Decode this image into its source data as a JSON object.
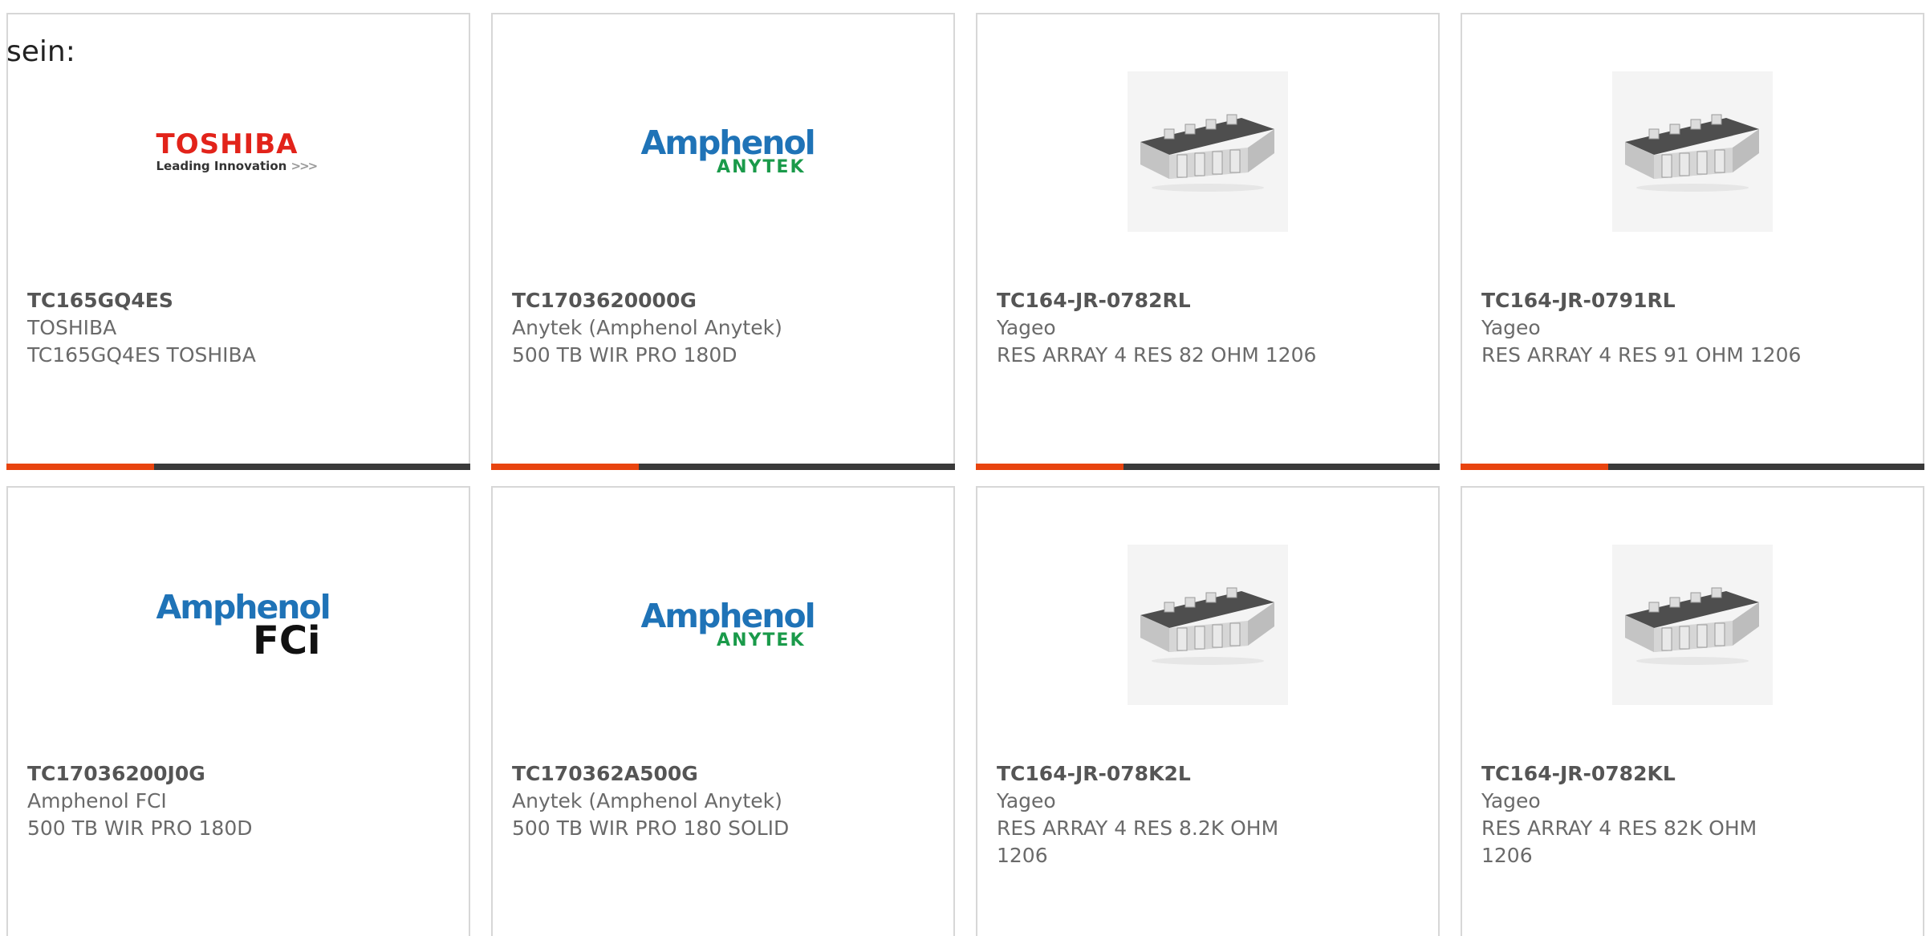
{
  "intro_text": "sein:",
  "brand_colors": {
    "accent_bar": "#e8440f",
    "bar": "#3a3a3a",
    "toshiba_red": "#e2231a",
    "amphenol_blue": "#1f73b7",
    "anytek_green": "#1a9a4a"
  },
  "logos": {
    "toshiba": {
      "name": "TOSHIBA",
      "tagline": "Leading Innovation",
      "chevrons": ">>>"
    },
    "amphenol_anytek": {
      "name": "Amphenol",
      "sub": "ANYTEK"
    },
    "amphenol_fci": {
      "name": "Amphenol",
      "sub": "FCi"
    }
  },
  "products": [
    {
      "part": "TC165GQ4ES",
      "manufacturer": "TOSHIBA",
      "description": "TC165GQ4ES TOSHIBA",
      "image": "toshiba-logo"
    },
    {
      "part": "TC1703620000G",
      "manufacturer": "Anytek (Amphenol Anytek)",
      "description": "500 TB WIR PRO 180D",
      "image": "amphenol-anytek-logo"
    },
    {
      "part": "TC164-JR-0782RL",
      "manufacturer": "Yageo",
      "description": "RES ARRAY 4 RES 82 OHM 1206",
      "image": "resistor-array-photo"
    },
    {
      "part": "TC164-JR-0791RL",
      "manufacturer": "Yageo",
      "description": "RES ARRAY 4 RES 91 OHM 1206",
      "image": "resistor-array-photo"
    },
    {
      "part": "TC17036200J0G",
      "manufacturer": "Amphenol FCI",
      "description": "500 TB WIR PRO 180D",
      "image": "amphenol-fci-logo"
    },
    {
      "part": "TC170362A500G",
      "manufacturer": "Anytek (Amphenol Anytek)",
      "description": "500 TB WIR PRO 180 SOLID",
      "image": "amphenol-anytek-logo"
    },
    {
      "part": "TC164-JR-078K2L",
      "manufacturer": "Yageo",
      "description": "RES ARRAY 4 RES 8.2K OHM 1206",
      "image": "resistor-array-photo"
    },
    {
      "part": "TC164-JR-0782KL",
      "manufacturer": "Yageo",
      "description": "RES ARRAY 4 RES 82K OHM 1206",
      "image": "resistor-array-photo"
    }
  ]
}
